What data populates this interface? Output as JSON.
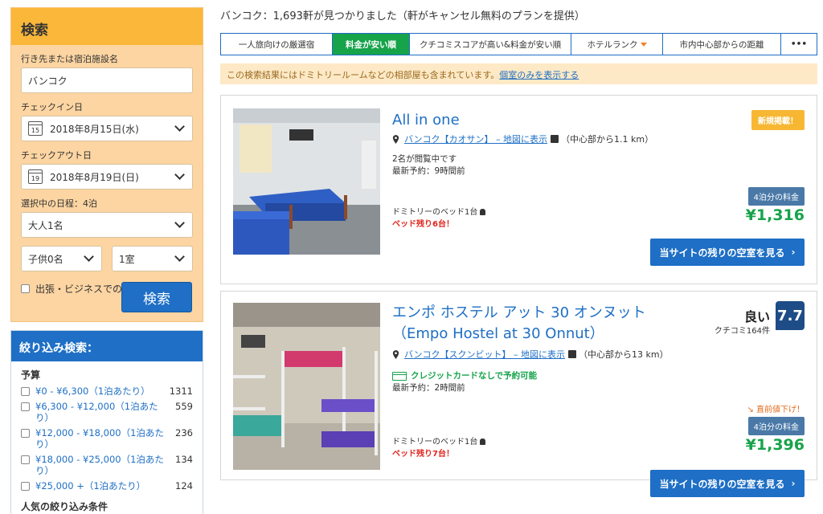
{
  "search": {
    "title": "検索",
    "destination_label": "行き先または宿泊施設名",
    "destination_value": "バンコク",
    "checkin_label": "チェックイン日",
    "checkin_day": "15",
    "checkin_value": "2018年8月15日(水)",
    "checkout_label": "チェックアウト日",
    "checkout_day": "19",
    "checkout_value": "2018年8月19日(日)",
    "nights_label": "選択中の日程：4泊",
    "adults": "大人1名",
    "children": "子供0名",
    "rooms": "1室",
    "business_label": "出張・ビジネスでの利用",
    "help_icon": "?",
    "button": "検索"
  },
  "filter": {
    "title": "絞り込み検索：",
    "budget_label": "予算",
    "budget_items": [
      {
        "label": "¥0 - ¥6,300（1泊あたり）",
        "count": "1311"
      },
      {
        "label": "¥6,300 - ¥12,000（1泊あたり）",
        "count": "559"
      },
      {
        "label": "¥12,000 - ¥18,000（1泊あたり）",
        "count": "236"
      },
      {
        "label": "¥18,000 - ¥25,000（1泊あたり）",
        "count": "134"
      },
      {
        "label": "¥25,000 +（1泊あたり）",
        "count": "124"
      }
    ],
    "popular_label": "人気の絞り込み条件"
  },
  "results_title": "バンコク：1,693軒が見つかりました（軒がキャンセル無料のプランを提供）",
  "sort_tabs": [
    "一人旅向けの厳選宿",
    "料金が安い順",
    "クチコミスコアが高い&料金が安い順",
    "ホテルランク",
    "市内中心部からの距離",
    "•••"
  ],
  "notice": {
    "text": "この検索結果にはドミトリールームなどの相部屋も含まれています。",
    "link": "個室のみを表示する"
  },
  "hotels": [
    {
      "name": "All in one",
      "badge": "新規掲載！",
      "area": "バンコク【カオサン】 – 地図に表示",
      "distance": "（中心部から1.1 km）",
      "viewing": "2名が閲覧中です",
      "last_booked": "最新予約：9時間前",
      "bed": "ドミトリーのベッド1台",
      "beds_left": "ベッド残り6台！",
      "price_label": "4泊分の料金",
      "price": "¥1,316",
      "cta": "当サイトの残りの空室を見る",
      "cta_arrow": "›"
    },
    {
      "name": "エンポ ホステル アット 30 オンヌット（Empo Hostel at 30 Onnut）",
      "rating_word": "良い",
      "rating_count": "クチコミ164件",
      "rating_score": "7.7",
      "area": "バンコク【スクンビット】 – 地図に表示",
      "distance": "（中心部から13 km）",
      "no_card": "クレジットカードなしで予約可能",
      "last_booked": "最新予約：2時間前",
      "price_drop": "↘ 直前値下げ！",
      "bed": "ドミトリーのベッド1台",
      "beds_left": "ベッド残り7台！",
      "price_label": "4泊分の料金",
      "price": "¥1,396",
      "cta": "当サイトの残りの空室を見る",
      "cta_arrow": "›"
    }
  ]
}
